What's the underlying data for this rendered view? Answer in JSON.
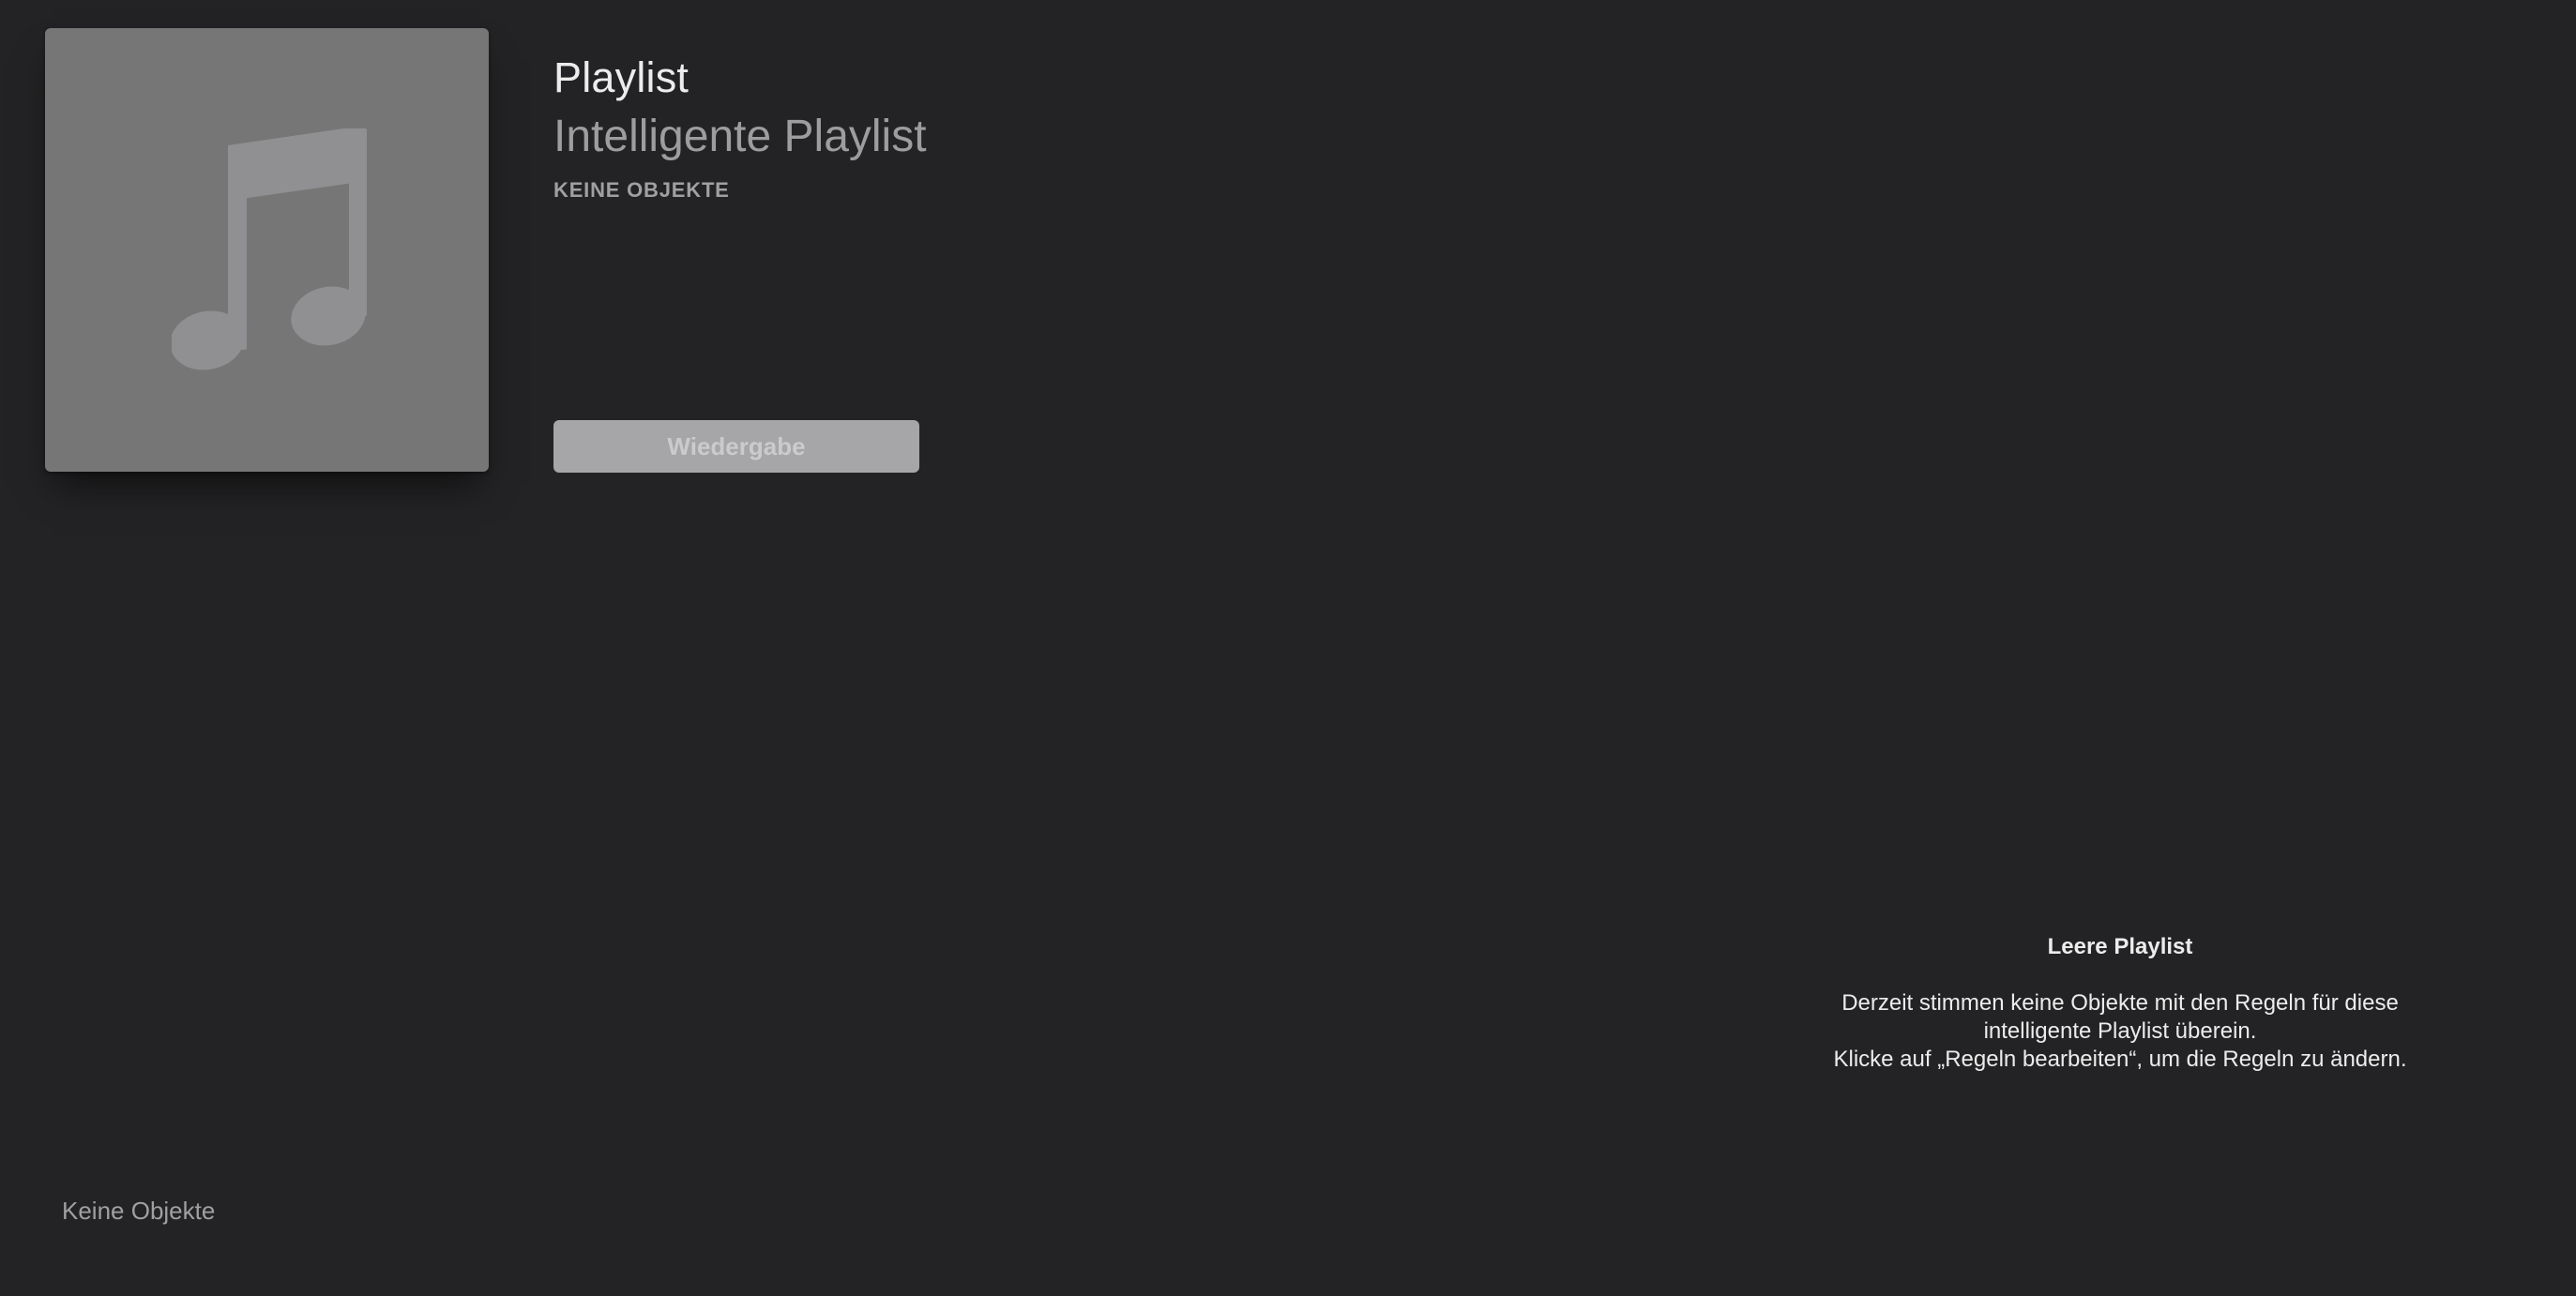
{
  "header": {
    "title": "Playlist",
    "subtitle": "Intelligente Playlist",
    "item_count": "KEINE OBJEKTE",
    "artwork_icon": "music-note-icon",
    "play_button_label": "Wiedergabe"
  },
  "empty_state": {
    "title": "Leere Playlist",
    "lines": [
      "Derzeit stimmen keine Objekte mit den Regeln für diese",
      "intelligente Playlist überein.",
      "Klicke auf „Regeln bearbeiten“, um die Regeln zu ändern."
    ]
  },
  "footer": {
    "status": "Keine Objekte"
  },
  "colors": {
    "background": "#232325",
    "artwork_bg": "#767676",
    "artwork_note": "#909092",
    "button_bg": "#a6a6a8",
    "button_text": "#cbcbcd",
    "secondary_text": "#9d9d9f",
    "primary_text": "#ececec"
  }
}
